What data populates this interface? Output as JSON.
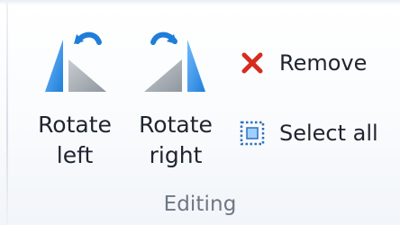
{
  "group": {
    "label": "Editing"
  },
  "buttons": {
    "rotate_left": {
      "label": "Rotate\nleft",
      "icon": "rotate-left-icon"
    },
    "rotate_right": {
      "label": "Rotate\nright",
      "icon": "rotate-right-icon"
    },
    "remove": {
      "label": "Remove",
      "icon": "remove-x-icon"
    },
    "select_all": {
      "label": "Select all",
      "icon": "select-all-icon"
    }
  },
  "colors": {
    "accent_blue": "#1f7ed8",
    "remove_red": "#d62c1f",
    "gray_shape": "#9aa1a8",
    "select_border": "#2f6fbe",
    "select_fill": "#9fd0ff"
  }
}
